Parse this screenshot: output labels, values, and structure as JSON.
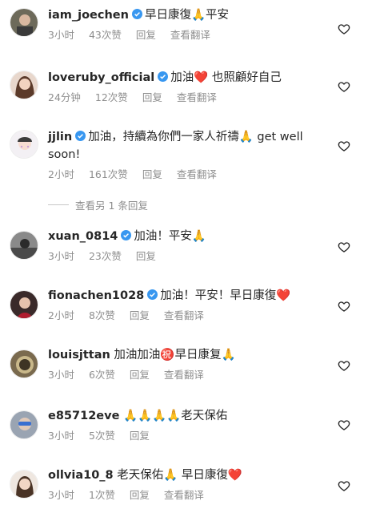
{
  "comments": [
    {
      "username": "iam_joechen",
      "verified": true,
      "text": "早日康復🙏平安",
      "time": "3小时",
      "likes": "43次赞",
      "reply": "回复",
      "translate": "查看翻译"
    },
    {
      "username": "loveruby_official",
      "verified": true,
      "text": "加油❤️ 也照顧好自己",
      "time": "24分钟",
      "likes": "12次赞",
      "reply": "回复",
      "translate": "查看翻译"
    },
    {
      "username": "jjlin",
      "verified": true,
      "text": "加油，持續為你們一家人祈禱🙏 get well soon!",
      "time": "2小时",
      "likes": "161次赞",
      "reply": "回复",
      "translate": "查看翻译"
    },
    {
      "username": "xuan_0814",
      "verified": true,
      "text": "加油！平安🙏",
      "time": "3小时",
      "likes": "23次赞",
      "reply": "回复"
    },
    {
      "username": "fionachen1028",
      "verified": true,
      "text": "加油！平安！早日康復❤️",
      "time": "2小时",
      "likes": "8次赞",
      "reply": "回复",
      "translate": "查看翻译"
    },
    {
      "username": "louisjttan",
      "verified": false,
      "text": "加油加油㊗️早日康复🙏",
      "time": "3小时",
      "likes": "6次赞",
      "reply": "回复",
      "translate": "查看翻译"
    },
    {
      "username": "e85712eve",
      "verified": false,
      "text": "🙏🙏🙏🙏老天保佑",
      "time": "3小时",
      "likes": "5次赞",
      "reply": "回复"
    },
    {
      "username": "ollvia10_8",
      "verified": false,
      "text": "老天保佑🙏 早日康復❤️",
      "time": "3小时",
      "likes": "1次赞",
      "reply": "回复",
      "translate": "查看翻译"
    }
  ],
  "more_replies": "查看另 1 条回复",
  "colors": {
    "verified": "#3897f0",
    "meta": "#8e8e8e",
    "text": "#262626",
    "heart_outline": "#262626"
  },
  "icons": {
    "verified": "verified-badge-icon",
    "heart": "heart-outline-icon"
  }
}
